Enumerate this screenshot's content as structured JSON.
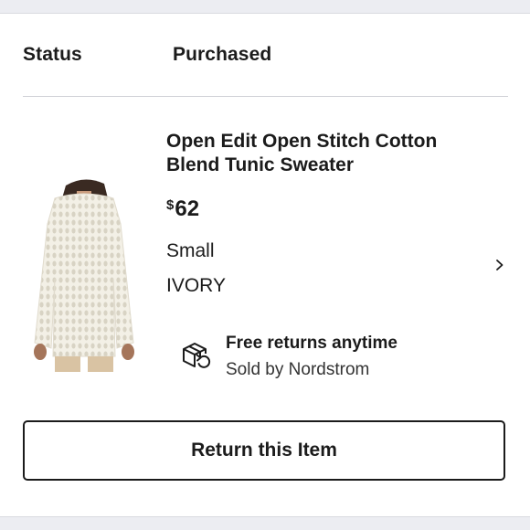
{
  "order": {
    "status_label": "Status",
    "status_value": "Purchased"
  },
  "product": {
    "title": "Open Edit Open Stitch Cotton Blend Tunic Sweater",
    "price_currency": "$",
    "price_amount": "62",
    "size": "Small",
    "color": "IVORY",
    "image_icon": "ivory-crochet-tunic-sweater-photo"
  },
  "returns": {
    "icon": "box-return-icon",
    "title": "Free returns anytime",
    "seller": "Sold by Nordstrom"
  },
  "actions": {
    "return_label": "Return this Item",
    "details_icon": "chevron-right-icon"
  },
  "colors": {
    "page_background": "#ecedf2",
    "card_background": "#ffffff",
    "text": "#1b1b1b",
    "divider": "#cfd0d6",
    "sweater": "#f1eee3"
  }
}
